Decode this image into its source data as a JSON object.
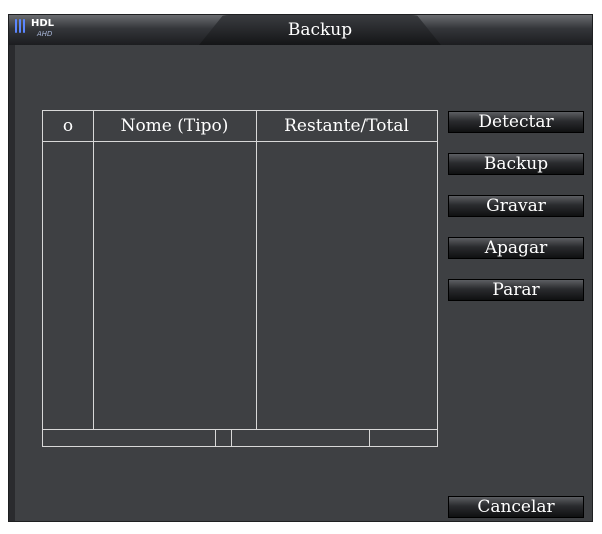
{
  "window": {
    "title": "Backup",
    "logo_text": "HDL",
    "logo_sub": "AHD"
  },
  "table": {
    "headers": [
      "o",
      "Nome (Tipo)",
      "Restante/Total"
    ]
  },
  "buttons": {
    "detect": "Detectar",
    "backup": "Backup",
    "burn": "Gravar",
    "erase": "Apagar",
    "stop": "Parar",
    "cancel": "Cancelar"
  }
}
